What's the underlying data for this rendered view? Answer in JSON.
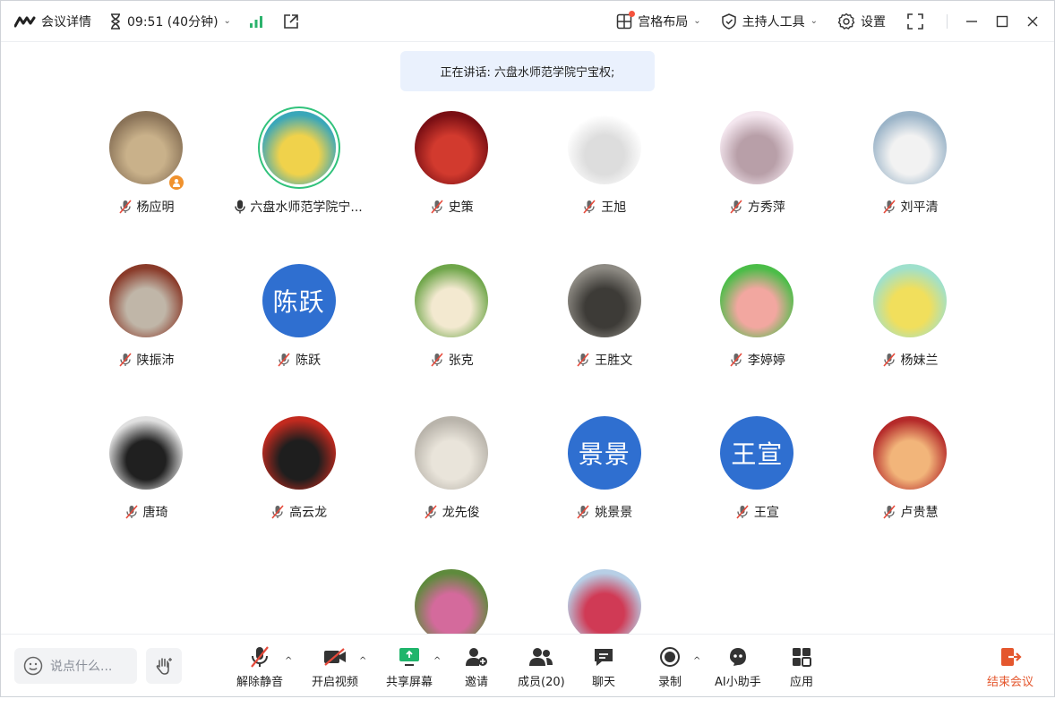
{
  "titlebar": {
    "meeting_details": "会议详情",
    "timer": "09:51 (40分钟)",
    "layout": "宫格布局",
    "host_tools": "主持人工具",
    "settings": "设置"
  },
  "speaking": "正在讲话: 六盘水师范学院宁宝权;",
  "colors": {
    "accent": "#2f6fd0",
    "active_ring": "#30c27b",
    "end": "#e4572e",
    "banner": "#eaf1fd"
  },
  "participants": [
    {
      "name": "杨应明",
      "avatar": "photo-family",
      "mic": "muted",
      "host_badge": true
    },
    {
      "name": "六盘水师范学院宁...",
      "avatar": "photo-children",
      "mic": "speaking",
      "active": true
    },
    {
      "name": "史策",
      "avatar": "photo-red-abstract",
      "mic": "muted"
    },
    {
      "name": "王旭",
      "avatar": "photo-cartoon-boy",
      "mic": "muted"
    },
    {
      "name": "方秀萍",
      "avatar": "photo-cartoon-couple",
      "mic": "muted"
    },
    {
      "name": "刘平清",
      "avatar": "photo-white-dog",
      "mic": "muted"
    },
    {
      "name": "陕振沛",
      "avatar": "photo-building",
      "mic": "muted"
    },
    {
      "name": "陈跃",
      "avatar_text": "陈跃",
      "mic": "muted"
    },
    {
      "name": "张克",
      "avatar": "photo-sheep-cartoon",
      "mic": "muted"
    },
    {
      "name": "王胜文",
      "avatar": "photo-people",
      "mic": "muted"
    },
    {
      "name": "李婷婷",
      "avatar": "photo-girl-cartoon",
      "mic": "muted"
    },
    {
      "name": "杨妹兰",
      "avatar": "photo-yellow-cartoon",
      "mic": "muted"
    },
    {
      "name": "唐琦",
      "avatar": "photo-bw-portrait",
      "mic": "muted"
    },
    {
      "name": "高云龙",
      "avatar": "photo-graduation",
      "mic": "muted"
    },
    {
      "name": "龙先俊",
      "avatar": "photo-teddy-bear",
      "mic": "muted"
    },
    {
      "name": "姚景景",
      "avatar_text": "景景",
      "mic": "muted"
    },
    {
      "name": "王宣",
      "avatar_text": "王宣",
      "mic": "muted"
    },
    {
      "name": "卢贵慧",
      "avatar": "photo-tiger-cartoon",
      "mic": "muted"
    },
    {
      "name": "",
      "avatar": "photo-flower",
      "mic": "none"
    },
    {
      "name": "",
      "avatar": "photo-child",
      "mic": "none"
    }
  ],
  "bottombar": {
    "chat_placeholder": "说点什么...",
    "unmute": "解除静音",
    "start_video": "开启视频",
    "share_screen": "共享屏幕",
    "invite": "邀请",
    "members": "成员(20)",
    "chat": "聊天",
    "record": "录制",
    "ai_assistant": "AI小助手",
    "apps": "应用",
    "end_meeting": "结束会议"
  }
}
